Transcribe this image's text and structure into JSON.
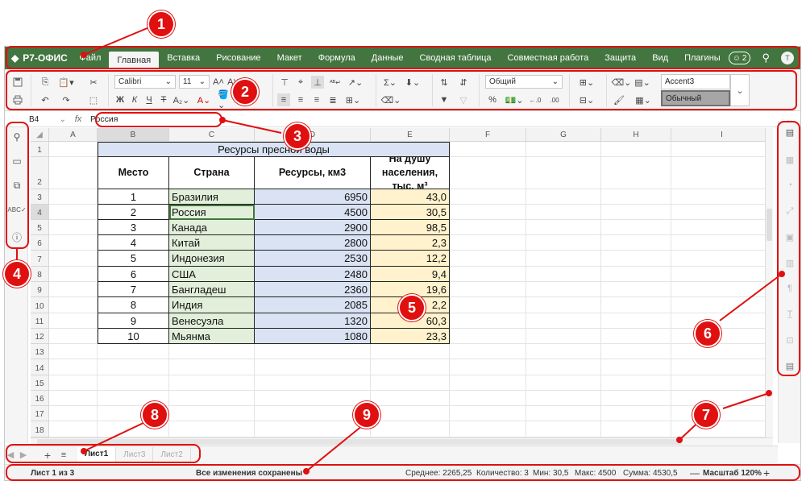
{
  "app": {
    "logo": "Р7-ОФИС"
  },
  "menu": [
    "Файл",
    "Главная",
    "Вставка",
    "Рисование",
    "Макет",
    "Формула",
    "Данные",
    "Сводная таблица",
    "Совместная работа",
    "Защита",
    "Вид",
    "Плагины"
  ],
  "menu_active": "Главная",
  "header_right": {
    "users_count": "2",
    "avatar_letter": "T"
  },
  "ribbon": {
    "font_name": "Calibri",
    "font_size": "11",
    "number_format": "Общий",
    "styles": [
      "Accent3",
      "Обычный"
    ],
    "percent_symbol": "%"
  },
  "formula_bar": {
    "cell_ref": "B4",
    "fx": "fx",
    "value": "Россия"
  },
  "columns": [
    "A",
    "B",
    "C",
    "D",
    "E",
    "F",
    "G",
    "H",
    "I"
  ],
  "rows": [
    "1",
    "2",
    "3",
    "4",
    "5",
    "6",
    "7",
    "8",
    "9",
    "10",
    "11",
    "12",
    "13",
    "14",
    "15",
    "16",
    "17",
    "18"
  ],
  "table": {
    "title": "Ресурсы пресной воды",
    "headers": [
      "Место",
      "Страна",
      "Ресурсы, км3",
      "На душу населения, тыс. м³"
    ],
    "data": [
      [
        "1",
        "Бразилия",
        "6950",
        "43,0"
      ],
      [
        "2",
        "Россия",
        "4500",
        "30,5"
      ],
      [
        "3",
        "Канада",
        "2900",
        "98,5"
      ],
      [
        "4",
        "Китай",
        "2800",
        "2,3"
      ],
      [
        "5",
        "Индонезия",
        "2530",
        "12,2"
      ],
      [
        "6",
        "США",
        "2480",
        "9,4"
      ],
      [
        "7",
        "Бангладеш",
        "2360",
        "19,6"
      ],
      [
        "8",
        "Индия",
        "2085",
        "2,2"
      ],
      [
        "9",
        "Венесуэла",
        "1320",
        "60,3"
      ],
      [
        "10",
        "Мьянма",
        "1080",
        "23,3"
      ]
    ]
  },
  "sheets": [
    "Лист1",
    "Лист3",
    "Лист2"
  ],
  "status": {
    "sheet_info": "Лист 1 из 3",
    "saved": "Все изменения сохранены",
    "average": "Среднее: 2265,25",
    "count": "Количество: 3",
    "min": "Мин: 30,5",
    "max": "Макс: 4500",
    "sum": "Сумма: 4530,5",
    "zoom": "Масштаб 120%"
  },
  "callouts": [
    "1",
    "2",
    "3",
    "4",
    "5",
    "6",
    "7",
    "8",
    "9"
  ],
  "colors": {
    "brand": "#42753f",
    "callout": "#e01010",
    "col_b": "#e2efda",
    "col_c": "#dae3f3",
    "col_d": "#fff2cc"
  }
}
